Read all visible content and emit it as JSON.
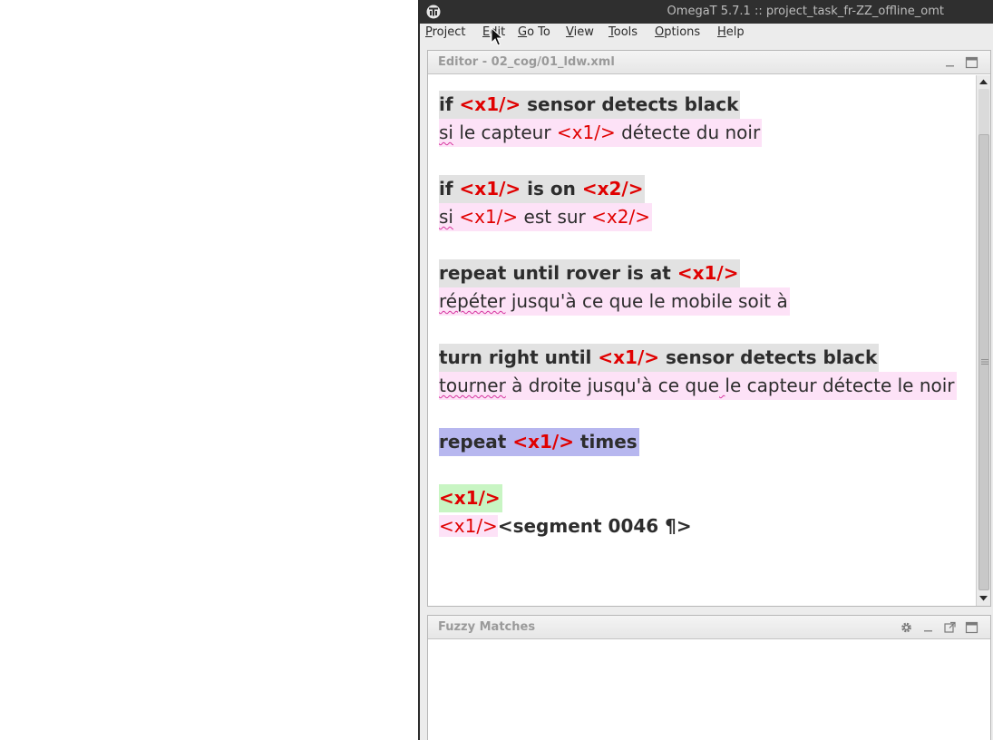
{
  "window": {
    "title": "OmegaT 5.7.1 :: project_task_fr-ZZ_offline_omt"
  },
  "menu": {
    "items": [
      {
        "mnemonic": "P",
        "rest": "roject"
      },
      {
        "mnemonic": "E",
        "rest": "dit"
      },
      {
        "mnemonic": "G",
        "rest": "o To"
      },
      {
        "mnemonic": "V",
        "rest": "iew"
      },
      {
        "mnemonic": "T",
        "rest": "ools"
      },
      {
        "mnemonic": "O",
        "rest": "ptions"
      },
      {
        "mnemonic": "H",
        "rest": "elp"
      }
    ]
  },
  "editor": {
    "title": "Editor - 02_cog/01_ldw.xml",
    "segments": [
      {
        "source": [
          "if ",
          "<x1/>",
          " sensor detects black"
        ],
        "target_a": "si",
        "target_b": " le capteur ",
        "target_tag": "<x1/>",
        "target_c": " détecte du noir"
      },
      {
        "source": [
          "if ",
          "<x1/>",
          " is on ",
          "<x2/>"
        ],
        "target_a": "si",
        "target_b": " ",
        "target_tag": "<x1/>",
        "target_c": " est sur ",
        "target_tag2": "<x2/>"
      },
      {
        "source": [
          "repeat until rover is at ",
          "<x1/>"
        ],
        "target_a": "répéter",
        "target_c": " jusqu'à ce que le mobile soit à "
      },
      {
        "source": [
          "turn right until ",
          "<x1/>",
          " sensor detects black"
        ],
        "target_a": "tourner",
        "target_c": " à droite jusqu'à ce que",
        "target_d": " ",
        "target_e": " le capteur détecte le noir"
      },
      {
        "source": [
          "repeat ",
          "<x1/>",
          " times"
        ]
      },
      {
        "source": [
          "<x1/>"
        ],
        "target_tag": "<x1/>",
        "marker": "<segment 0046 ¶>"
      }
    ]
  },
  "fuzzy": {
    "title": "Fuzzy Matches"
  },
  "icons": {
    "app": "omegat-logo-icon",
    "settings": "gear-icon",
    "minimize": "minimize-icon",
    "undock": "undock-icon",
    "maximize": "maximize-icon",
    "cursor": "mouse-pointer-icon"
  }
}
